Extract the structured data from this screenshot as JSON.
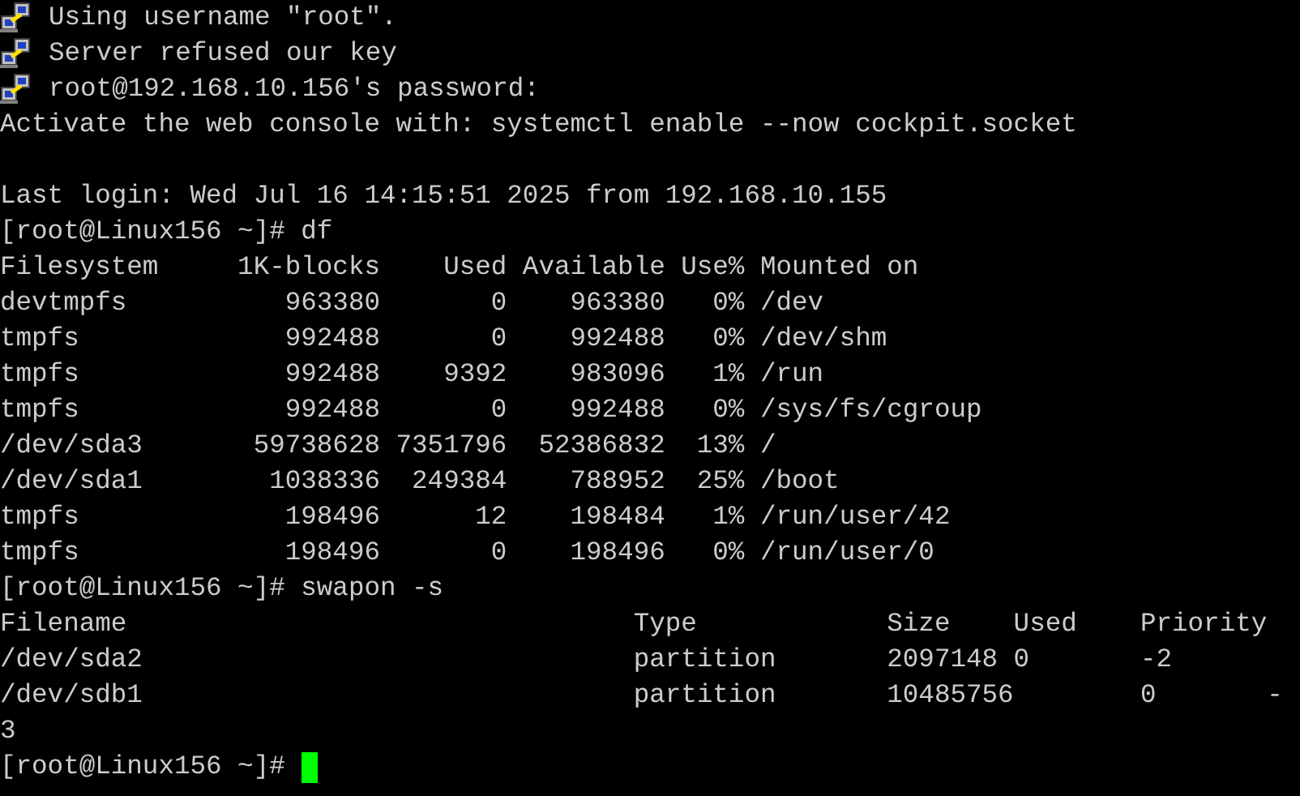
{
  "terminal": {
    "lines": [
      {
        "kind": "message",
        "text": "Using username \"root\"."
      },
      {
        "kind": "message",
        "text": "Server refused our key"
      },
      {
        "kind": "message",
        "text": "root@192.168.10.156's password:"
      },
      {
        "kind": "output",
        "text": "Activate the web console with: systemctl enable --now cockpit.socket"
      },
      {
        "kind": "blank"
      },
      {
        "kind": "output",
        "text": "Last login: Wed Jul 16 14:15:51 2025 from 192.168.10.155"
      },
      {
        "kind": "output",
        "text": "[root@Linux156 ~]# df"
      },
      {
        "kind": "output",
        "text": "Filesystem     1K-blocks    Used Available Use% Mounted on"
      },
      {
        "kind": "output",
        "text": "devtmpfs          963380       0    963380   0% /dev"
      },
      {
        "kind": "output",
        "text": "tmpfs             992488       0    992488   0% /dev/shm"
      },
      {
        "kind": "output",
        "text": "tmpfs             992488    9392    983096   1% /run"
      },
      {
        "kind": "output",
        "text": "tmpfs             992488       0    992488   0% /sys/fs/cgroup"
      },
      {
        "kind": "output",
        "text": "/dev/sda3       59738628 7351796  52386832  13% /"
      },
      {
        "kind": "output",
        "text": "/dev/sda1        1038336  249384    788952  25% /boot"
      },
      {
        "kind": "output",
        "text": "tmpfs             198496      12    198484   1% /run/user/42"
      },
      {
        "kind": "output",
        "text": "tmpfs             198496       0    198496   0% /run/user/0"
      },
      {
        "kind": "output",
        "text": "[root@Linux156 ~]# swapon -s"
      },
      {
        "kind": "output",
        "text": "Filename                                Type            Size    Used    Priority"
      },
      {
        "kind": "output",
        "text": "/dev/sda2                               partition       2097148 0       -2"
      },
      {
        "kind": "output",
        "text": "/dev/sdb1                               partition       10485756        0       -"
      },
      {
        "kind": "output",
        "text": "3"
      },
      {
        "kind": "prompt",
        "text": "[root@Linux156 ~]#",
        "cursor": true
      }
    ]
  }
}
